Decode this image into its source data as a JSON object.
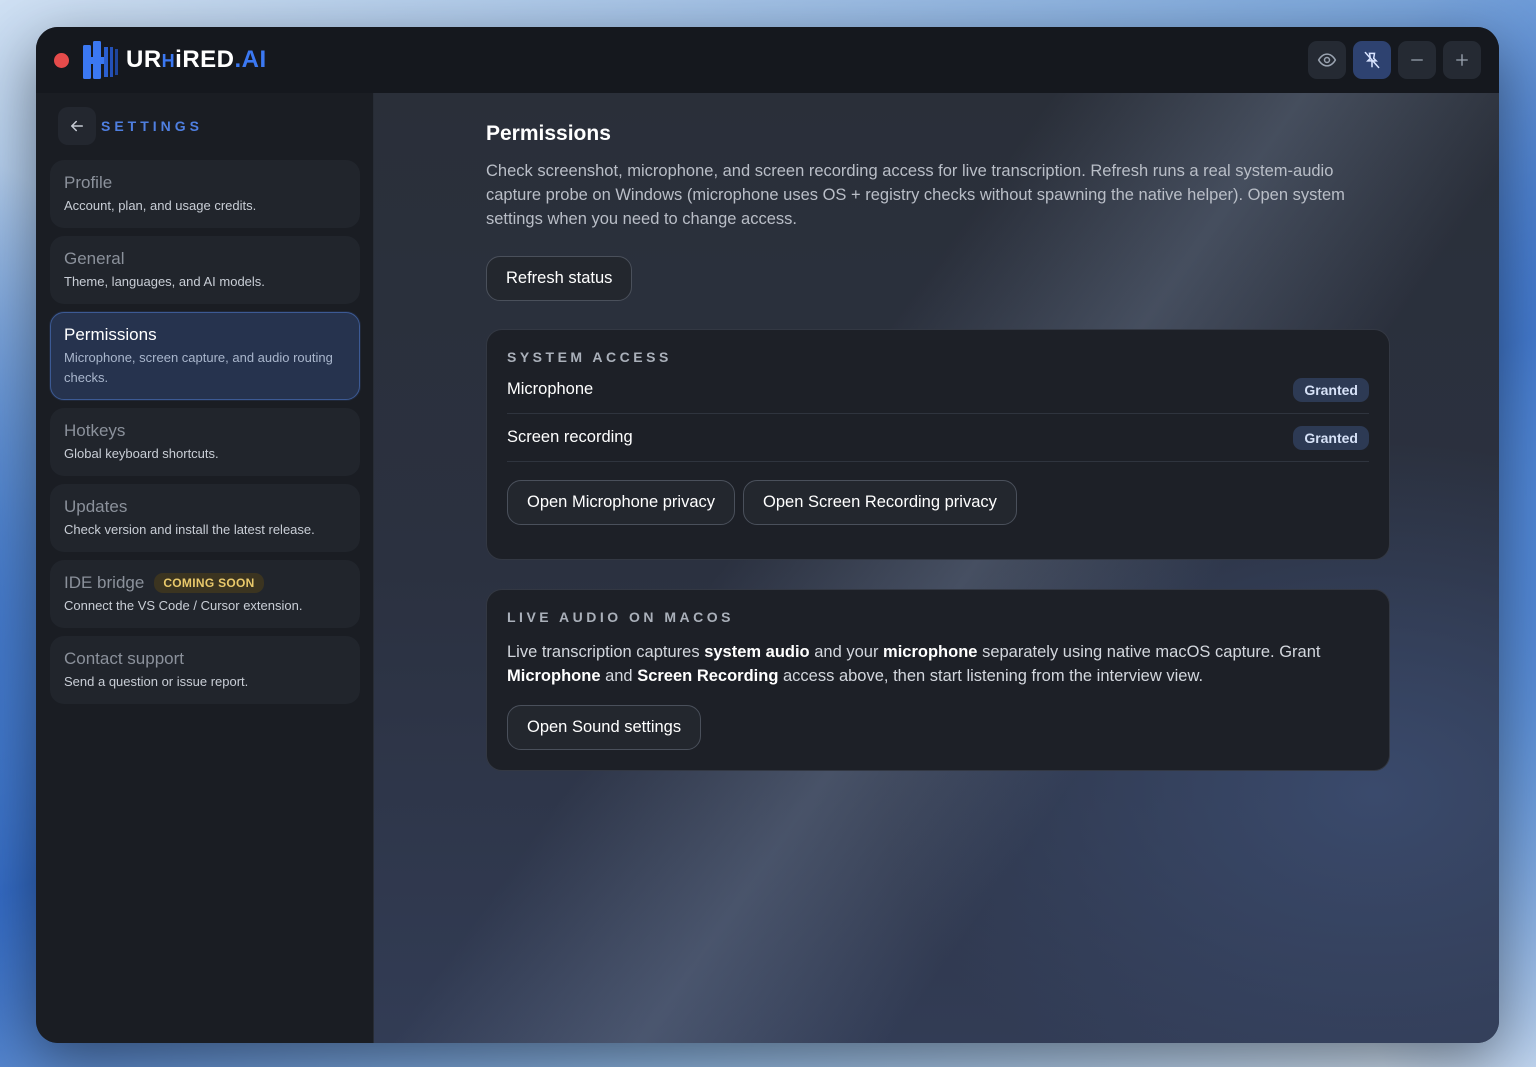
{
  "app": {
    "logo_text_1": "UR",
    "logo_text_2": "iRED",
    "logo_text_3": ".AI",
    "record_color": "#e54b4b",
    "accent": "#3b78f2"
  },
  "window_controls": {
    "icons": [
      "eye-icon",
      "pin-off-icon",
      "minus-icon",
      "plus-icon"
    ]
  },
  "sidebar": {
    "back_label": "SETTINGS",
    "items": [
      {
        "title": "Profile",
        "subtitle": "Account, plan, and usage credits."
      },
      {
        "title": "General",
        "subtitle": "Theme, languages, and AI models."
      },
      {
        "title": "Permissions",
        "subtitle": "Microphone, screen capture, and audio routing checks."
      },
      {
        "title": "Hotkeys",
        "subtitle": "Global keyboard shortcuts."
      },
      {
        "title": "Updates",
        "subtitle": "Check version and install the latest release."
      },
      {
        "title": "IDE bridge",
        "subtitle": "Connect the VS Code / Cursor extension.",
        "badge": "COMING SOON"
      },
      {
        "title": "Contact support",
        "subtitle": "Send a question or issue report."
      }
    ]
  },
  "main": {
    "title": "Permissions",
    "description": "Check screenshot, microphone, and screen recording access for live transcription. Refresh runs a real system-audio capture probe on Windows (microphone uses OS + registry checks without spawning the native helper). Open system settings when you need to change access.",
    "refresh_label": "Refresh status",
    "system_access": {
      "heading": "SYSTEM ACCESS",
      "rows": [
        {
          "label": "Microphone",
          "status": "Granted"
        },
        {
          "label": "Screen recording",
          "status": "Granted"
        }
      ],
      "open_mic_label": "Open Microphone privacy",
      "open_screen_label": "Open Screen Recording privacy"
    },
    "live_audio": {
      "heading": "LIVE AUDIO ON MACOS",
      "t1": "Live transcription captures ",
      "b1": "system audio",
      "t2": " and your ",
      "b2": "microphone",
      "t3": " separately using native macOS capture. Grant ",
      "b3": "Microphone",
      "t4": " and ",
      "b4": "Screen Recording",
      "t5": " access above, then start listening from the interview view.",
      "sound_label": "Open Sound settings"
    }
  }
}
